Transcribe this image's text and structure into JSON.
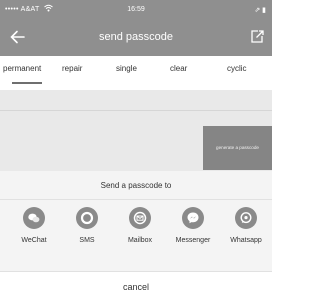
{
  "status_bar": {
    "carrier": "••••• A&AT",
    "time": "16:59",
    "battery": "⇗ ▮"
  },
  "nav": {
    "title": "send passcode"
  },
  "tabs": [
    {
      "label": "permanent",
      "active": true
    },
    {
      "label": "repair"
    },
    {
      "label": "single"
    },
    {
      "label": "clear"
    },
    {
      "label": "cyclic"
    }
  ],
  "generate_button": {
    "label": "generate a passcode"
  },
  "share_sheet": {
    "title": "Send a passcode to",
    "options": [
      {
        "label": "WeChat",
        "icon": "wechat-icon"
      },
      {
        "label": "SMS",
        "icon": "sms-icon"
      },
      {
        "label": "Mailbox",
        "icon": "mail-icon"
      },
      {
        "label": "Messenger",
        "icon": "messenger-icon"
      },
      {
        "label": "Whatsapp",
        "icon": "whatsapp-icon"
      }
    ],
    "cancel_label": "cancel"
  },
  "colors": {
    "bar": "#8f8f8f",
    "button": "#858585",
    "icon": "#8a8a8a"
  }
}
